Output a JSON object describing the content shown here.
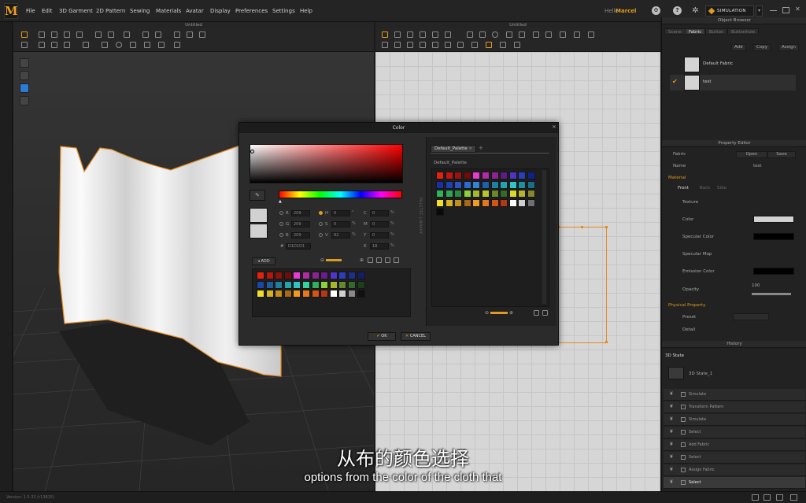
{
  "app": {
    "logo": "M"
  },
  "menu": [
    "File",
    "Edit",
    "3D Garment",
    "2D Pattern",
    "Sewing",
    "Materials",
    "Avatar",
    "Display",
    "Preferences",
    "Settings",
    "Help"
  ],
  "user": {
    "prefix": "Hello",
    "name": "Marcel"
  },
  "simulation_button": "SIMULATION",
  "viewport3d": {
    "title": "Untitled"
  },
  "viewport2d": {
    "title": "Untitled"
  },
  "object_browser": {
    "title": "Object Browser",
    "tabs": [
      "Scene",
      "Fabric",
      "Button",
      "Buttonhole"
    ],
    "active_tab": "Fabric",
    "buttons": {
      "add": "Add",
      "copy": "Copy",
      "assign": "Assign"
    },
    "fabrics": [
      {
        "name": "Default Fabric",
        "checked": false
      },
      {
        "name": "test",
        "checked": true
      }
    ]
  },
  "property_editor": {
    "title": "Property Editor",
    "fabric_label": "Fabric",
    "open_btn": "Open",
    "save_btn": "Save",
    "name_label": "Name",
    "name_value": "test",
    "material_section": "Material",
    "tabs": [
      "Front",
      "Back",
      "Side"
    ],
    "texture": "Texture",
    "color": "Color",
    "color_value": "#d1d1d1",
    "specular_color": "Specular Color",
    "specular_map": "Specular Map",
    "emission_color": "Emission Color",
    "opacity": "Opacity",
    "opacity_value": "100",
    "physical_section": "Physical Property",
    "preset": "Preset",
    "detail": "Detail"
  },
  "history": {
    "title": "History",
    "state_label": "3D State",
    "state_item": "3D State_1",
    "items": [
      "Simulate",
      "Transform Pattern",
      "Simulate",
      "Select",
      "Add Fabric",
      "Select",
      "Assign Fabric",
      "Select"
    ],
    "selected_index": 7
  },
  "status": {
    "version": "Version: 1.5.33 (r13815)"
  },
  "color_dialog": {
    "title": "Color",
    "fields": {
      "R": "209",
      "G": "209",
      "B": "209",
      "H": "0",
      "S": "0",
      "V": "82",
      "C": "0",
      "M": "0",
      "Y": "0",
      "K": "18",
      "hash": "D1D1D1"
    },
    "add_btn": "ADD",
    "palette_library": "PALETTE LIBRARY",
    "palette_tab": "Default_Palette",
    "palette_name": "Default_Palette",
    "ok": "OK",
    "cancel": "CANCEL",
    "left_swatches": [
      [
        "#e4230f",
        "#b8160d",
        "#8d1209",
        "#700d0a",
        "#e53bd5",
        "#b12ca4",
        "#8a2493",
        "#6a1d86",
        "#4f34c8",
        "#2a3fc0",
        "#1d2e8c",
        "#141e63"
      ],
      [
        "#1b47a8",
        "#1c5c9e",
        "#1f7fa3",
        "#22a3b0",
        "#2fc4c6",
        "#34d39b",
        "#2fb25c",
        "#8ad13c",
        "#a4b92a",
        "#66882a",
        "#34692a",
        "#1c3f1a"
      ],
      [
        "#efde2e",
        "#d6b122",
        "#c58d1c",
        "#a86818",
        "#ef9b22",
        "#e6771d",
        "#d45417",
        "#b33813",
        "#ffffff",
        "#cfcfcf",
        "#8a8a8a",
        "#101010"
      ]
    ],
    "right_swatches": [
      [
        "#e4230f",
        "#c1160d",
        "#9a1209",
        "#6e0d0a",
        "#e53bd5",
        "#b12ca4",
        "#8a2493",
        "#5c1e86",
        "#4f34c8",
        "#2a3fc0",
        "#14208a"
      ],
      [
        "#1b2fa8",
        "#1e3fb3",
        "#2a52c2",
        "#2d6bd1",
        "#3183d6",
        "#1f5fb0",
        "#1f7fa3",
        "#22a3b0",
        "#2fc4c6",
        "#1c8fa0",
        "#196c8c"
      ],
      [
        "#2fb25c",
        "#34a35a",
        "#2a8a42",
        "#8ad13c",
        "#a4b92a",
        "#b6c62a",
        "#66882a",
        "#34692a",
        "#d9d92a",
        "#b6b62a",
        "#86862a"
      ],
      [
        "#efde2e",
        "#d6b122",
        "#c58d1c",
        "#a86818",
        "#ef9b22",
        "#e6771d",
        "#d45417",
        "#b33813",
        "#ffffff",
        "#cfcfcf",
        "#6f6f6f"
      ],
      [
        "#0a0a0a"
      ]
    ]
  },
  "subtitles": {
    "cn": "从布的颜色选择",
    "en": "options from the color of the cloth that"
  }
}
